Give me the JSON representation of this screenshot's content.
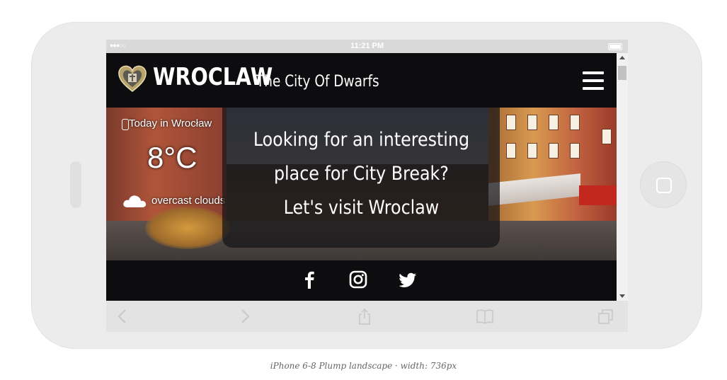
{
  "status_bar": {
    "signal": "●●●○○",
    "time": "11:21 PM"
  },
  "header": {
    "logo_icon": "heart-crest-icon",
    "title": "WROCLAW",
    "subtitle": "The City Of Dwarfs",
    "menu_icon": "hamburger-menu-icon"
  },
  "weather": {
    "title": "Today in Wrocław",
    "temperature": "8°C",
    "description": "overcast clouds",
    "icon": "cloud-icon"
  },
  "hero": {
    "tagline": "Looking for an interesting\nplace for City Break?\nLet's visit Wroclaw"
  },
  "social": [
    {
      "icon": "facebook-icon"
    },
    {
      "icon": "instagram-icon"
    },
    {
      "icon": "twitter-icon"
    }
  ],
  "caption": "iPhone 6-8 Plump landscape · width: 736px",
  "colors": {
    "header_bg": "#0d0d0f",
    "overlay_bg": "rgba(20,20,22,0.72)",
    "device_frame": "#ececec",
    "toolbar_bg": "#e3e3e3"
  }
}
